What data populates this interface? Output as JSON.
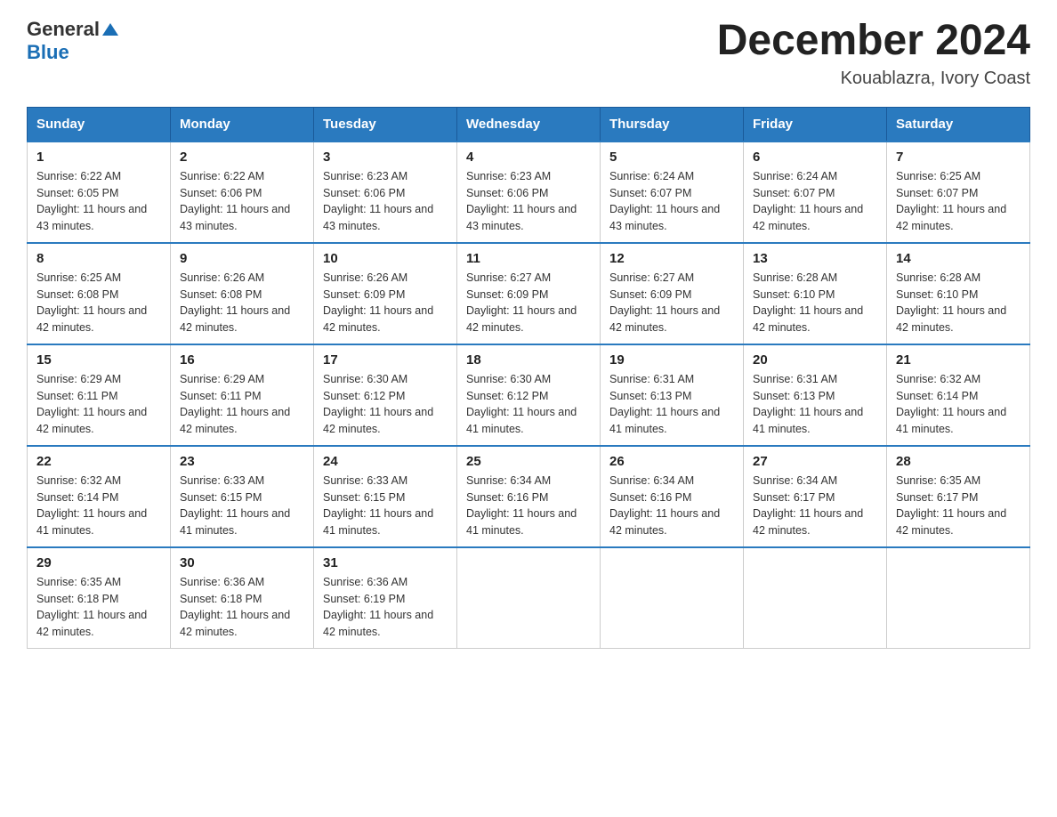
{
  "logo": {
    "text1": "General",
    "triangle": "▶",
    "text2": "Blue"
  },
  "title": "December 2024",
  "subtitle": "Kouablazra, Ivory Coast",
  "days_of_week": [
    "Sunday",
    "Monday",
    "Tuesday",
    "Wednesday",
    "Thursday",
    "Friday",
    "Saturday"
  ],
  "weeks": [
    [
      {
        "day": "1",
        "sunrise": "6:22 AM",
        "sunset": "6:05 PM",
        "daylight": "11 hours and 43 minutes."
      },
      {
        "day": "2",
        "sunrise": "6:22 AM",
        "sunset": "6:06 PM",
        "daylight": "11 hours and 43 minutes."
      },
      {
        "day": "3",
        "sunrise": "6:23 AM",
        "sunset": "6:06 PM",
        "daylight": "11 hours and 43 minutes."
      },
      {
        "day": "4",
        "sunrise": "6:23 AM",
        "sunset": "6:06 PM",
        "daylight": "11 hours and 43 minutes."
      },
      {
        "day": "5",
        "sunrise": "6:24 AM",
        "sunset": "6:07 PM",
        "daylight": "11 hours and 43 minutes."
      },
      {
        "day": "6",
        "sunrise": "6:24 AM",
        "sunset": "6:07 PM",
        "daylight": "11 hours and 42 minutes."
      },
      {
        "day": "7",
        "sunrise": "6:25 AM",
        "sunset": "6:07 PM",
        "daylight": "11 hours and 42 minutes."
      }
    ],
    [
      {
        "day": "8",
        "sunrise": "6:25 AM",
        "sunset": "6:08 PM",
        "daylight": "11 hours and 42 minutes."
      },
      {
        "day": "9",
        "sunrise": "6:26 AM",
        "sunset": "6:08 PM",
        "daylight": "11 hours and 42 minutes."
      },
      {
        "day": "10",
        "sunrise": "6:26 AM",
        "sunset": "6:09 PM",
        "daylight": "11 hours and 42 minutes."
      },
      {
        "day": "11",
        "sunrise": "6:27 AM",
        "sunset": "6:09 PM",
        "daylight": "11 hours and 42 minutes."
      },
      {
        "day": "12",
        "sunrise": "6:27 AM",
        "sunset": "6:09 PM",
        "daylight": "11 hours and 42 minutes."
      },
      {
        "day": "13",
        "sunrise": "6:28 AM",
        "sunset": "6:10 PM",
        "daylight": "11 hours and 42 minutes."
      },
      {
        "day": "14",
        "sunrise": "6:28 AM",
        "sunset": "6:10 PM",
        "daylight": "11 hours and 42 minutes."
      }
    ],
    [
      {
        "day": "15",
        "sunrise": "6:29 AM",
        "sunset": "6:11 PM",
        "daylight": "11 hours and 42 minutes."
      },
      {
        "day": "16",
        "sunrise": "6:29 AM",
        "sunset": "6:11 PM",
        "daylight": "11 hours and 42 minutes."
      },
      {
        "day": "17",
        "sunrise": "6:30 AM",
        "sunset": "6:12 PM",
        "daylight": "11 hours and 42 minutes."
      },
      {
        "day": "18",
        "sunrise": "6:30 AM",
        "sunset": "6:12 PM",
        "daylight": "11 hours and 41 minutes."
      },
      {
        "day": "19",
        "sunrise": "6:31 AM",
        "sunset": "6:13 PM",
        "daylight": "11 hours and 41 minutes."
      },
      {
        "day": "20",
        "sunrise": "6:31 AM",
        "sunset": "6:13 PM",
        "daylight": "11 hours and 41 minutes."
      },
      {
        "day": "21",
        "sunrise": "6:32 AM",
        "sunset": "6:14 PM",
        "daylight": "11 hours and 41 minutes."
      }
    ],
    [
      {
        "day": "22",
        "sunrise": "6:32 AM",
        "sunset": "6:14 PM",
        "daylight": "11 hours and 41 minutes."
      },
      {
        "day": "23",
        "sunrise": "6:33 AM",
        "sunset": "6:15 PM",
        "daylight": "11 hours and 41 minutes."
      },
      {
        "day": "24",
        "sunrise": "6:33 AM",
        "sunset": "6:15 PM",
        "daylight": "11 hours and 41 minutes."
      },
      {
        "day": "25",
        "sunrise": "6:34 AM",
        "sunset": "6:16 PM",
        "daylight": "11 hours and 41 minutes."
      },
      {
        "day": "26",
        "sunrise": "6:34 AM",
        "sunset": "6:16 PM",
        "daylight": "11 hours and 42 minutes."
      },
      {
        "day": "27",
        "sunrise": "6:34 AM",
        "sunset": "6:17 PM",
        "daylight": "11 hours and 42 minutes."
      },
      {
        "day": "28",
        "sunrise": "6:35 AM",
        "sunset": "6:17 PM",
        "daylight": "11 hours and 42 minutes."
      }
    ],
    [
      {
        "day": "29",
        "sunrise": "6:35 AM",
        "sunset": "6:18 PM",
        "daylight": "11 hours and 42 minutes."
      },
      {
        "day": "30",
        "sunrise": "6:36 AM",
        "sunset": "6:18 PM",
        "daylight": "11 hours and 42 minutes."
      },
      {
        "day": "31",
        "sunrise": "6:36 AM",
        "sunset": "6:19 PM",
        "daylight": "11 hours and 42 minutes."
      },
      null,
      null,
      null,
      null
    ]
  ]
}
